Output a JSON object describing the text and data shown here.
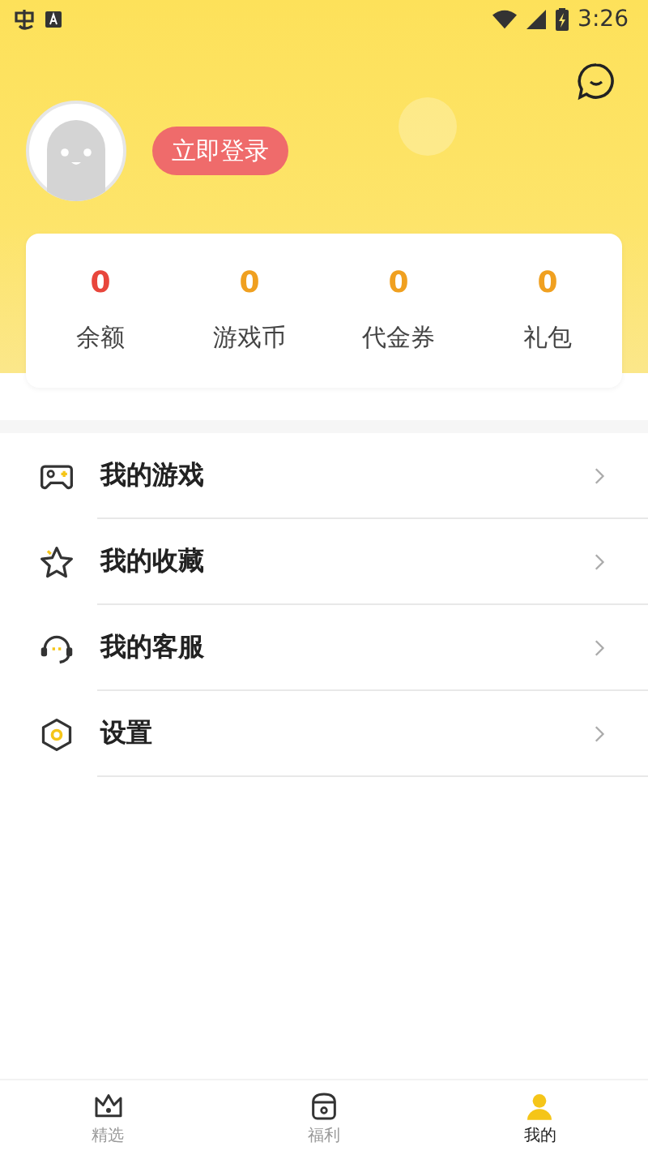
{
  "status_bar": {
    "time": "3:26"
  },
  "profile": {
    "login_button": "立即登录"
  },
  "stats": [
    {
      "value": "0",
      "label": "余额",
      "color": "#e8463c"
    },
    {
      "value": "0",
      "label": "游戏币",
      "color": "#f0a020"
    },
    {
      "value": "0",
      "label": "代金券",
      "color": "#f0a020"
    },
    {
      "value": "0",
      "label": "礼包",
      "color": "#f0a020"
    }
  ],
  "menu": [
    {
      "kind": "game",
      "label": "我的游戏"
    },
    {
      "kind": "star",
      "label": "我的收藏"
    },
    {
      "kind": "service",
      "label": "我的客服"
    },
    {
      "kind": "settings",
      "label": "设置"
    }
  ],
  "tabs": [
    {
      "kind": "crown",
      "label": "精选",
      "selected": false
    },
    {
      "kind": "gift",
      "label": "福利",
      "selected": false
    },
    {
      "kind": "person",
      "label": "我的",
      "selected": true
    }
  ]
}
